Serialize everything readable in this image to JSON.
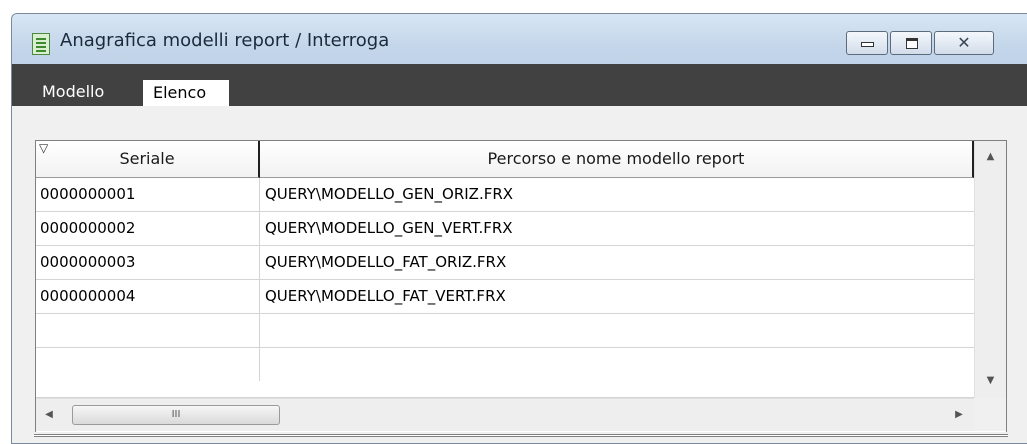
{
  "window": {
    "title": "Anagrafica modelli report / Interroga",
    "close_glyph": "✕"
  },
  "tabs": [
    {
      "label": "Modello",
      "active": false
    },
    {
      "label": "Elenco",
      "active": true
    }
  ],
  "grid": {
    "columns": [
      "Seriale",
      "Percorso e nome modello report"
    ],
    "rows": [
      {
        "seriale": "0000000001",
        "percorso": "QUERY\\MODELLO_GEN_ORIZ.FRX"
      },
      {
        "seriale": "0000000002",
        "percorso": "QUERY\\MODELLO_GEN_VERT.FRX"
      },
      {
        "seriale": "0000000003",
        "percorso": "QUERY\\MODELLO_FAT_ORIZ.FRX"
      },
      {
        "seriale": "0000000004",
        "percorso": "QUERY\\MODELLO_FAT_VERT.FRX"
      },
      {
        "seriale": "",
        "percorso": ""
      },
      {
        "seriale": "",
        "percorso": ""
      }
    ]
  },
  "scrollbars": {
    "up_glyph": "▲",
    "down_glyph": "▼",
    "left_glyph": "◀",
    "right_glyph": "▶",
    "thumb_grip": "III"
  },
  "colors": {
    "tab_bar": "#414141",
    "title_bar": "#c4d6ea",
    "client_bg": "#f0f0f0"
  },
  "icons": [
    "app-form-icon",
    "minimize-icon",
    "maximize-icon",
    "close-icon",
    "sort-indicator-icon"
  ]
}
